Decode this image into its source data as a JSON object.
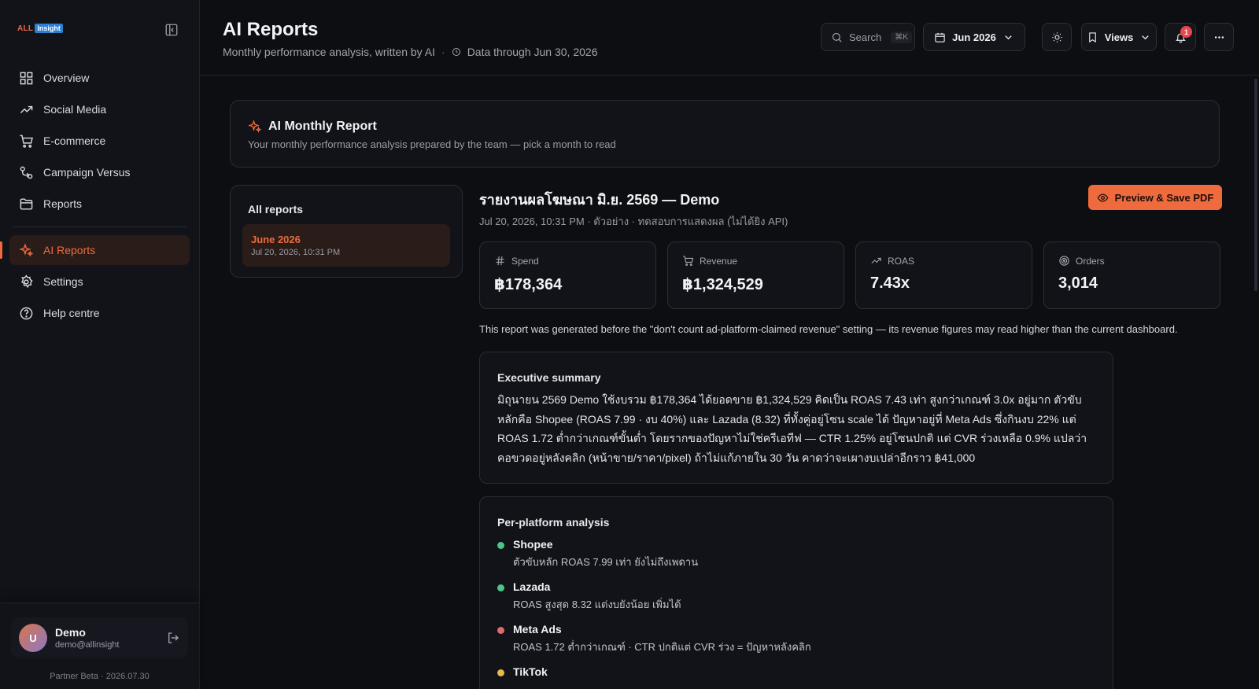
{
  "brand": {
    "part1": "ALL",
    "part2": "Insight"
  },
  "sidebar": {
    "items": [
      {
        "label": "Overview",
        "icon": "grid-icon"
      },
      {
        "label": "Social Media",
        "icon": "trend-icon"
      },
      {
        "label": "E-commerce",
        "icon": "cart-icon"
      },
      {
        "label": "Campaign Versus",
        "icon": "versus-icon"
      },
      {
        "label": "Reports",
        "icon": "folder-icon"
      }
    ],
    "secondary": [
      {
        "label": "AI Reports",
        "icon": "sparkle-icon",
        "active": true
      },
      {
        "label": "Settings",
        "icon": "gear-icon"
      },
      {
        "label": "Help centre",
        "icon": "help-icon"
      }
    ],
    "user": {
      "initial": "U",
      "name": "Demo",
      "email": "demo@allinsight"
    },
    "version": "Partner Beta · 2026.07.30"
  },
  "header": {
    "title": "AI Reports",
    "subtitle": "Monthly performance analysis, written by AI",
    "separator": "·",
    "data_through": "Data through Jun 30, 2026",
    "search_label": "Search",
    "search_kbd": "⌘K",
    "date": "Jun 2026",
    "views": "Views",
    "notifications": "1"
  },
  "hero": {
    "title": "AI Monthly Report",
    "subtitle": "Your monthly performance analysis prepared by the team — pick a month to read"
  },
  "reports_list": {
    "title": "All reports",
    "items": [
      {
        "title": "June 2026",
        "date": "Jul 20, 2026, 10:31 PM"
      }
    ]
  },
  "report": {
    "title": "รายงานผลโฆษณา มิ.ย. 2569 — Demo",
    "meta": "Jul 20, 2026, 10:31 PM · ตัวอย่าง · ทดสอบการแสดงผล (ไม่ได้ยิง API)",
    "pdf_button": "Preview & Save PDF",
    "kpis": [
      {
        "label": "Spend",
        "value": "฿178,364",
        "icon": "hash-icon"
      },
      {
        "label": "Revenue",
        "value": "฿1,324,529",
        "icon": "cart-icon"
      },
      {
        "label": "ROAS",
        "value": "7.43x",
        "icon": "trend-icon"
      },
      {
        "label": "Orders",
        "value": "3,014",
        "icon": "target-icon"
      }
    ],
    "note": "This report was generated before the \"don't count ad-platform-claimed revenue\" setting — its revenue figures may read higher than the current dashboard.",
    "executive_summary": {
      "title": "Executive summary",
      "body": "มิถุนายน 2569 Demo ใช้งบรวม ฿178,364 ได้ยอดขาย ฿1,324,529 คิดเป็น ROAS 7.43 เท่า สูงกว่าเกณฑ์ 3.0x อยู่มาก ตัวขับหลักคือ Shopee (ROAS 7.99 · งบ 40%) และ Lazada (8.32) ที่ทั้งคู่อยู่โซน scale ได้ ปัญหาอยู่ที่ Meta Ads ซึ่งกินงบ 22% แต่ ROAS 1.72 ต่ำกว่าเกณฑ์ขั้นต่ำ โดยรากของปัญหาไม่ใช่ครีเอทีฟ — CTR 1.25% อยู่โซนปกติ แต่ CVR ร่วงเหลือ 0.9% แปลว่าคอขวดอยู่หลังคลิก (หน้าขาย/ราคา/pixel) ถ้าไม่แก้ภายใน 30 วัน คาดว่าจะเผางบเปล่าอีกราว ฿41,000"
    },
    "platform_analysis": {
      "title": "Per-platform analysis",
      "items": [
        {
          "name": "Shopee",
          "desc": "ตัวขับหลัก ROAS 7.99 เท่า ยังไม่ถึงเพดาน",
          "color": "#4fc28a"
        },
        {
          "name": "Lazada",
          "desc": "ROAS สูงสุด 8.32 แต่งบยังน้อย เพิ่มได้",
          "color": "#4fc28a"
        },
        {
          "name": "Meta Ads",
          "desc": "ROAS 1.72 ต่ำกว่าเกณฑ์ · CTR ปกติแต่ CVR ร่วง = ปัญหาหลังคลิก",
          "color": "#e26a6a"
        },
        {
          "name": "TikTok",
          "desc": "",
          "color": "#e8b84a"
        }
      ]
    }
  },
  "colors": {
    "accent": "#ef6a3c",
    "bg": "#0d0e12",
    "panel": "#121319"
  }
}
